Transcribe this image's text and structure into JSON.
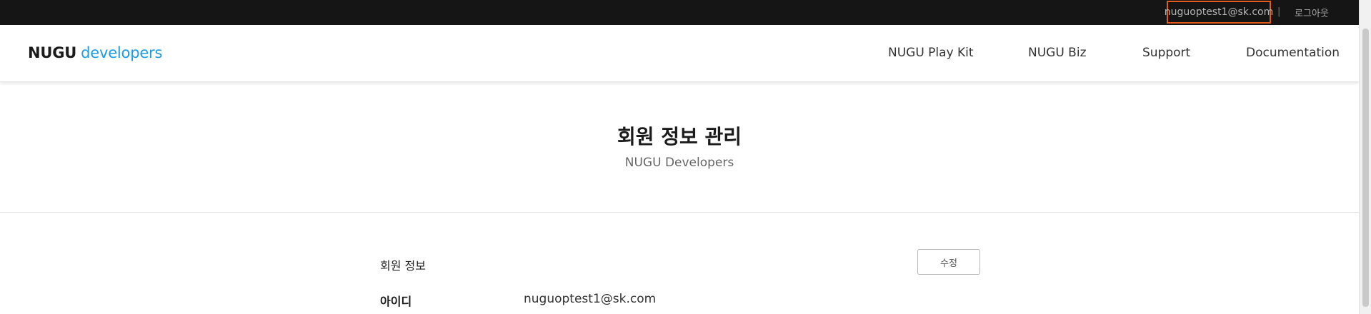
{
  "topbar": {
    "account_email": "nuguoptest1@sk.com",
    "divider": "|",
    "logout_label": "로그아웃",
    "highlight_color": "#e35a1b"
  },
  "header": {
    "logo_brand": "NUGU",
    "logo_sub": "developers",
    "nav": [
      {
        "label": "NUGU Play Kit"
      },
      {
        "label": "NUGU Biz"
      },
      {
        "label": "Support"
      },
      {
        "label": "Documentation"
      }
    ]
  },
  "title_section": {
    "title": "회원 정보 관리",
    "subtitle": "NUGU Developers"
  },
  "info_section": {
    "section_label": "회원 정보",
    "edit_button_label": "수정",
    "fields": [
      {
        "label": "아이디",
        "value": "nuguoptest1@sk.com"
      }
    ]
  },
  "colors": {
    "topbar_bg": "#151515",
    "logo_accent": "#1d9be5",
    "text_primary": "#1b1b1b"
  }
}
